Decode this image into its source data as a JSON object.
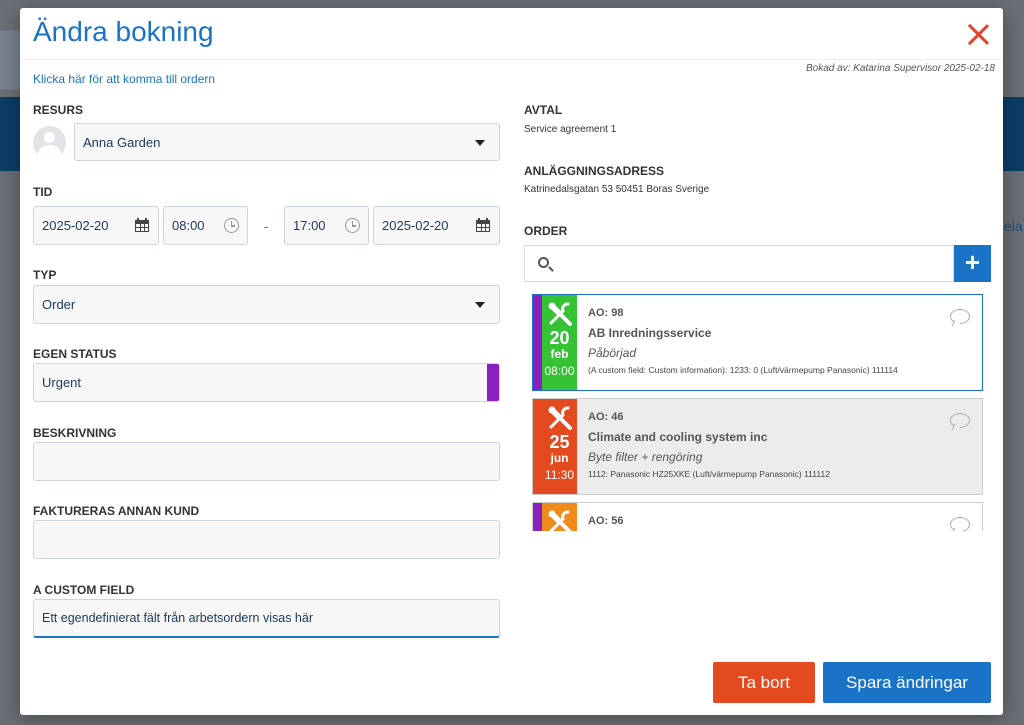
{
  "modal": {
    "title": "Ändra bokning",
    "booked_by": "Bokad av: Katarina Supervisor 2025-02-18",
    "order_link": "Klicka här för att komma till ordern"
  },
  "form": {
    "resource": {
      "label": "RESURS",
      "value": "Anna Garden"
    },
    "time": {
      "label": "TID",
      "start_date": "2025-02-20",
      "start_time": "08:00",
      "separator": "-",
      "end_time": "17:00",
      "end_date": "2025-02-20"
    },
    "type": {
      "label": "TYP",
      "value": "Order"
    },
    "own_status": {
      "label": "EGEN STATUS",
      "value": "Urgent",
      "color": "#8a1fc2"
    },
    "description": {
      "label": "BESKRIVNING",
      "value": ""
    },
    "invoice_other": {
      "label": "FAKTURERAS ANNAN KUND",
      "value": ""
    },
    "custom_field": {
      "label": "A CUSTOM FIELD",
      "value": "Ett egendefinierat fält från arbetsordern visas här"
    }
  },
  "info": {
    "agreement": {
      "label": "AVTAL",
      "value": "Service agreement 1"
    },
    "address": {
      "label": "ANLÄGGNINGSADRESS",
      "value": "Katrinedalsgatan 53 50451 Boras Sverige"
    },
    "order": {
      "label": "ORDER",
      "search_placeholder": "",
      "add_label": "+"
    }
  },
  "orders": [
    {
      "ao": "AO: 98",
      "customer": "AB Inredningsservice",
      "status": "Påbörjad",
      "extra": "(A custom field: Custom information): 1233: 0 (Luft/värmepump Panasonic) 111114",
      "day": "20",
      "month": "feb",
      "time": "08:00",
      "strip_color": "#8a1fc2",
      "date_color": "#35c235",
      "icon": "tools-icon"
    },
    {
      "ao": "AO: 46",
      "customer": "Climate and cooling system inc",
      "status": "Byte filter + rengöring",
      "extra": "1112: Panasonic HZ25XKE (Luft/värmepump Panasonic) 111112",
      "day": "25",
      "month": "jun",
      "time": "11:30",
      "strip_color": "#e34a1f",
      "date_color": "#e34a1f",
      "icon": "tools-icon"
    },
    {
      "ao": "AO: 56",
      "customer": "",
      "status": "",
      "extra": "",
      "day": "",
      "month": "",
      "time": "",
      "strip_color": "#8a1fc2",
      "date_color": "#f08a1a",
      "icon": "tools-icon"
    }
  ],
  "actions": {
    "delete_label": "Ta bort",
    "save_label": "Spara ändringar"
  },
  "background": {
    "edge_text": "ela"
  }
}
